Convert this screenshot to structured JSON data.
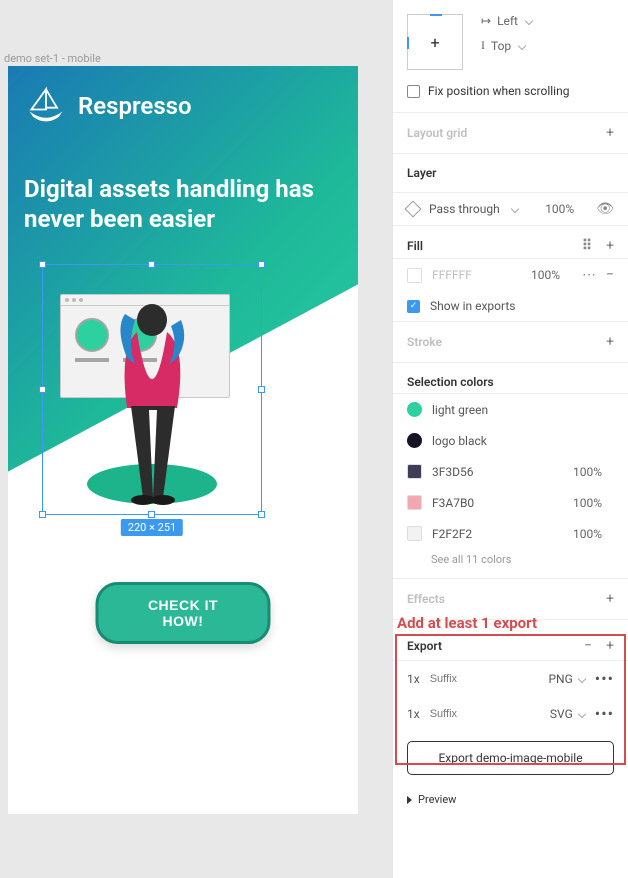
{
  "canvas": {
    "frame_label": "demo set-1 - mobile",
    "brand": "Respresso",
    "hero_title": "Digital assets handling has never been easier",
    "cta_label": "CHECK IT HOW!",
    "selection_dims": "220 × 251"
  },
  "inspector": {
    "constraints": {
      "horizontal": "Left",
      "vertical": "Top"
    },
    "fix_position_label": "Fix position when scrolling",
    "layout_grid": {
      "title": "Layout grid"
    },
    "layer": {
      "title": "Layer",
      "blend_mode": "Pass through",
      "opacity": "100%"
    },
    "fill": {
      "title": "Fill",
      "color_hex": "FFFFFF",
      "color_opacity": "100%",
      "show_exports_label": "Show in exports"
    },
    "stroke": {
      "title": "Stroke"
    },
    "selection_colors": {
      "title": "Selection colors",
      "items": [
        {
          "name": "light green",
          "hex": "#2dd19f",
          "shape": "circle"
        },
        {
          "name": "logo black",
          "hex": "#1a1326",
          "shape": "circle"
        },
        {
          "name": "3F3D56",
          "hex": "#3F3D56",
          "opacity": "100%",
          "shape": "square"
        },
        {
          "name": "F3A7B0",
          "hex": "#F3A7B0",
          "opacity": "100%",
          "shape": "square"
        },
        {
          "name": "F2F2F2",
          "hex": "#F2F2F2",
          "opacity": "100%",
          "shape": "square"
        }
      ],
      "see_all": "See all 11 colors"
    },
    "effects": {
      "title": "Effects"
    },
    "annotation": "Add at least 1 export",
    "export": {
      "title": "Export",
      "rows": [
        {
          "size": "1x",
          "suffix_ph": "Suffix",
          "format": "PNG"
        },
        {
          "size": "1x",
          "suffix_ph": "Suffix",
          "format": "SVG"
        }
      ],
      "button_label": "Export demo-image-mobile",
      "preview_label": "Preview"
    }
  }
}
